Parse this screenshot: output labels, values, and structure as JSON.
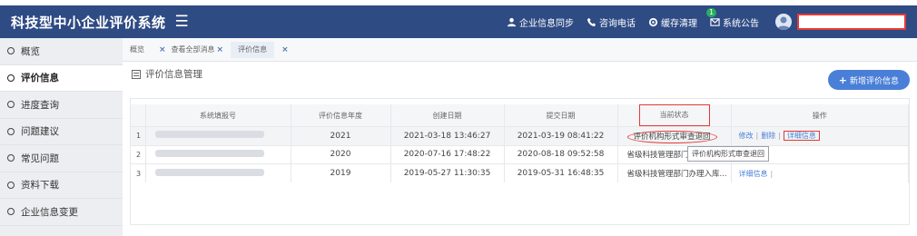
{
  "app": {
    "title": "科技型中小企业评价系统",
    "menu_icon": "hamburger-icon"
  },
  "header": {
    "links": [
      {
        "label": "企业信息同步",
        "icon": "user-icon"
      },
      {
        "label": "咨询电话",
        "icon": "phone-icon"
      },
      {
        "label": "缓存清理",
        "icon": "refresh-icon"
      },
      {
        "label": "系统公告",
        "icon": "message-icon",
        "badge": "1"
      }
    ],
    "avatar_icon": "avatar-icon",
    "username": ""
  },
  "sidebar": {
    "items": [
      {
        "label": "概览",
        "active": false
      },
      {
        "label": "评价信息",
        "active": true
      },
      {
        "label": "进度查询",
        "active": false
      },
      {
        "label": "问题建议",
        "active": false
      },
      {
        "label": "常见问题",
        "active": false
      },
      {
        "label": "资料下载",
        "active": false
      },
      {
        "label": "企业信息变更",
        "active": false
      }
    ]
  },
  "tabs": [
    {
      "label": "概览",
      "closable": false
    },
    {
      "label": "查看全部消息",
      "closable": true
    },
    {
      "label": "评价信息",
      "closable": true,
      "active": true
    }
  ],
  "section": {
    "title": "评价信息管理",
    "icon": "list-icon"
  },
  "add_button": {
    "label": "新增评价信息"
  },
  "table": {
    "headers": [
      "",
      "系统填报号",
      "评价信息年度",
      "创建日期",
      "提交日期",
      "当前状态",
      "操作"
    ],
    "rows": [
      {
        "index": "1",
        "number": "",
        "year": "2021",
        "created": "2021-03-18 13:46:27",
        "submitted": "2021-03-19 08:41:22",
        "status": "评价机构形式审查退回",
        "actions": [
          "修改",
          "删除",
          "详细信息"
        ]
      },
      {
        "index": "2",
        "number": "",
        "year": "2020",
        "created": "2020-07-16 17:48:22",
        "submitted": "2020-08-18 09:52:58",
        "status": "省级科技管理部门办理...",
        "actions": []
      },
      {
        "index": "3",
        "number": "",
        "year": "2019",
        "created": "2019-05-27 11:30:35",
        "submitted": "2019-05-31 16:48:35",
        "status": "省级科技管理部门办理入库...",
        "actions": [
          "详细信息"
        ]
      }
    ]
  },
  "tooltip": {
    "text": "评价机构形式审查退回"
  },
  "colors": {
    "header": "#2f4b84",
    "accent": "#4a7fd8",
    "annotation": "#e53935"
  }
}
